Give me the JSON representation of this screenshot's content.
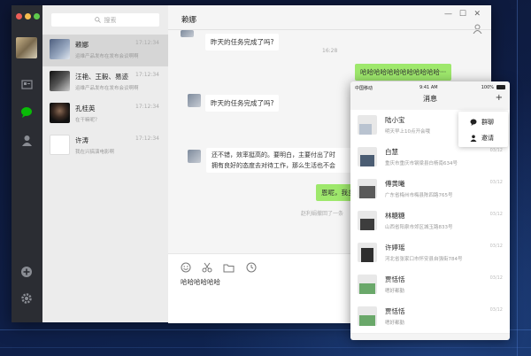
{
  "desktop": {
    "header": {
      "title": "赖娜"
    },
    "search": {
      "placeholder": "搜索"
    },
    "chats": [
      {
        "name": "赖娜",
        "time": "17:12:34",
        "preview": "运维产品发布在发布会议啊啊",
        "avatar_color": "#6f7f99"
      },
      {
        "name": "汪艳、王毅、易迹",
        "time": "17:12:34",
        "preview": "运维产品发布在发布会议啊啊",
        "avatar_color": "#333333"
      },
      {
        "name": "孔桂英",
        "time": "17:12:34",
        "preview": "在干嘛呢？",
        "avatar_color": "#2a2a2a"
      },
      {
        "name": "许涛",
        "time": "17:12:34",
        "preview": "我在兴搞演电影啊",
        "avatar_color": "#ffffff"
      }
    ],
    "messages": {
      "m1": "昨天的任务完成了吗?",
      "t1": "16:28",
      "m2": "哈哈哈哈哈哈哈哈哈哈哈哈···",
      "m3": "昨天的任务完成了吗?",
      "m4a": "还不错，效率挺高的。要明白，主要付出了时",
      "m4b": "拥有良好的态度去对待工作，那么生活也不会",
      "m5": "恩呢，我多明",
      "sys": "赵利娟撤回了一条"
    },
    "input": {
      "text": "哈哈哈哈哈哈"
    }
  },
  "phone": {
    "status": {
      "carrier": "中国移动",
      "time": "9:41 AM",
      "battery": "100%"
    },
    "title": "消息",
    "items": [
      {
        "name": "陆小宝",
        "preview": "明天早上10点开会哦",
        "time": ""
      },
      {
        "name": "白慧",
        "preview": "重庆市重庆市钢梁县白杨南634号",
        "time": "03/12"
      },
      {
        "name": "傅黄曦",
        "preview": "广东省梅州市梅县陈四路765号",
        "time": "03/12"
      },
      {
        "name": "林糖糖",
        "preview": "山西省阳泉市郊区城玉路833号",
        "time": "03/12"
      },
      {
        "name": "许婷瑶",
        "preview": "河北省张家口市怀安县自强街784号",
        "time": "03/12"
      },
      {
        "name": "贾恬恬",
        "preview": "嗯好都勤",
        "time": "03/12"
      },
      {
        "name": "贾恬恬",
        "preview": "嗯好都勤",
        "time": "03/12"
      }
    ],
    "popup": {
      "group_chat": "群聊",
      "invite": "邀请"
    }
  },
  "colors": {
    "accent_green": "#09bb07",
    "bubble_green": "#9ee86c",
    "sidebar": "#2b2d33",
    "backdrop": "#0e1a3a"
  }
}
